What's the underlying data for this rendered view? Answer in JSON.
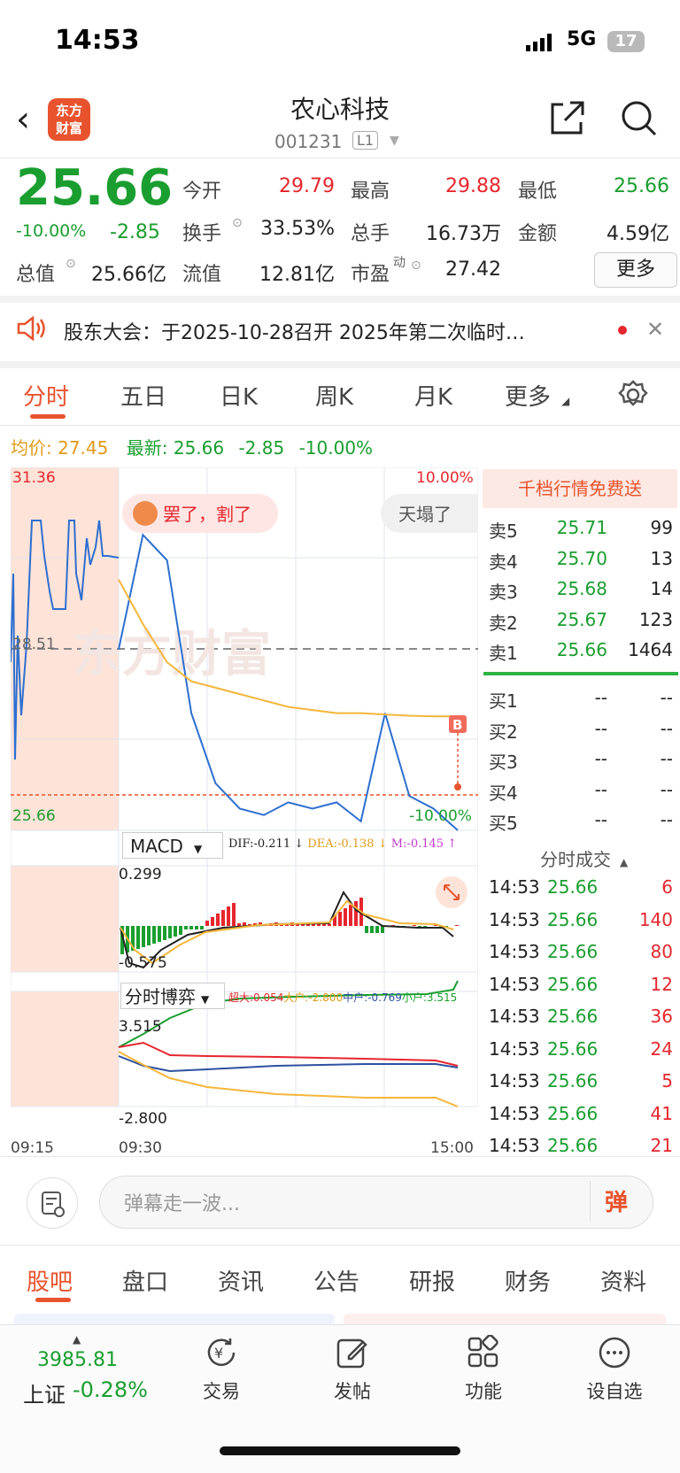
{
  "status_bar": {
    "time": "14:53",
    "network": "5G",
    "battery": "17"
  },
  "header": {
    "logo_text_line1": "东方",
    "logo_text_line2": "财富",
    "stock_name": "农心科技",
    "stock_code": "001231",
    "level_badge": "L1"
  },
  "quote": {
    "price": "25.66",
    "change_pct": "-10.00%",
    "change": "-2.85",
    "open_label": "今开",
    "open": "29.79",
    "high_label": "最高",
    "high": "29.88",
    "low_label": "最低",
    "low": "25.66",
    "turnover_label": "换手",
    "turnover": "33.53%",
    "volume_label": "总手",
    "volume": "16.73万",
    "amount_label": "金额",
    "amount": "4.59亿",
    "mktcap_label": "总值",
    "mktcap": "25.66亿",
    "float_label": "流值",
    "float": "12.81亿",
    "pe_label": "市盈",
    "pe_sup": "动",
    "pe": "27.42",
    "more_button": "更多"
  },
  "announcement": {
    "text": "股东大会：于2025-10-28召开 2025年第二次临时…"
  },
  "chart_tabs": [
    "分时",
    "五日",
    "日K",
    "周K",
    "月K",
    "更多"
  ],
  "info_row": {
    "avg_label": "均价:",
    "avg": "27.45",
    "latest_label": "最新:",
    "latest": "25.66",
    "change": "-2.85",
    "change_pct": "-10.00%"
  },
  "chart": {
    "top_left": "31.36",
    "top_right": "10.00%",
    "mid_left": "28.51",
    "bottom_left": "25.66",
    "bottom_right": "-10.00%",
    "bubble1": "罢了，割了",
    "bubble2": "天塌了",
    "b_marker": "B",
    "macd_label": "MACD",
    "macd_dif": "DIF:-0.211",
    "macd_dea": "DEA:-0.138",
    "macd_m": "M:-0.145",
    "macd_top": "0.299",
    "macd_bottom": "-0.575",
    "game_label": "分时博弈",
    "game_super": "超大:0.054",
    "game_big": "大户:-2.800",
    "game_mid": "中户:-0.769",
    "game_small": "小户:3.515",
    "game_top": "3.515",
    "game_bottom": "-2.800",
    "times": [
      "09:15",
      "09:30",
      "15:00"
    ],
    "watermark": "东方财富"
  },
  "chart_data": {
    "type": "line",
    "title": "",
    "x": [
      "09:15",
      "09:30",
      "15:00"
    ],
    "ylim": [
      25.66,
      31.36
    ],
    "series": [
      {
        "name": "最新",
        "values": [
          28.5,
          30.3,
          29.9,
          27.5,
          26.4,
          26.0,
          25.9,
          26.1,
          26.0,
          26.1,
          25.8,
          27.5,
          26.2,
          26.0,
          25.66
        ]
      },
      {
        "name": "均价",
        "values": [
          29.6,
          28.9,
          28.3,
          28.0,
          27.9,
          27.8,
          27.7,
          27.6,
          27.55,
          27.5,
          27.5,
          27.48,
          27.46,
          27.45,
          27.45
        ]
      }
    ]
  },
  "orderbook": {
    "free_banner": "千档行情免费送",
    "asks": [
      {
        "label": "卖5",
        "price": "25.71",
        "vol": "99"
      },
      {
        "label": "卖4",
        "price": "25.70",
        "vol": "13"
      },
      {
        "label": "卖3",
        "price": "25.68",
        "vol": "14"
      },
      {
        "label": "卖2",
        "price": "25.67",
        "vol": "123"
      },
      {
        "label": "卖1",
        "price": "25.66",
        "vol": "1464"
      }
    ],
    "bids": [
      {
        "label": "买1",
        "price": "--",
        "vol": "--"
      },
      {
        "label": "买2",
        "price": "--",
        "vol": "--"
      },
      {
        "label": "买3",
        "price": "--",
        "vol": "--"
      },
      {
        "label": "买4",
        "price": "--",
        "vol": "--"
      },
      {
        "label": "买5",
        "price": "--",
        "vol": "--"
      }
    ],
    "trades_title": "分时成交",
    "trades": [
      {
        "time": "14:53",
        "price": "25.66",
        "vol": "6"
      },
      {
        "time": "14:53",
        "price": "25.66",
        "vol": "140"
      },
      {
        "time": "14:53",
        "price": "25.66",
        "vol": "80"
      },
      {
        "time": "14:53",
        "price": "25.66",
        "vol": "12"
      },
      {
        "time": "14:53",
        "price": "25.66",
        "vol": "36"
      },
      {
        "time": "14:53",
        "price": "25.66",
        "vol": "24"
      },
      {
        "time": "14:53",
        "price": "25.66",
        "vol": "5"
      },
      {
        "time": "14:53",
        "price": "25.66",
        "vol": "41"
      },
      {
        "time": "14:53",
        "price": "25.66",
        "vol": "21"
      }
    ]
  },
  "comment": {
    "placeholder": "弹幕走一波...",
    "dan": "弹"
  },
  "bottom_tabs": [
    "股吧",
    "盘口",
    "资讯",
    "公告",
    "研报",
    "财务",
    "资料"
  ],
  "nav": {
    "index_value": "3985.81",
    "index_name": "上证",
    "index_pct": "-0.28%",
    "items": [
      "交易",
      "发帖",
      "功能",
      "设自选"
    ]
  },
  "colors": {
    "up": "#e6262e",
    "down": "#1a9e2f",
    "accent": "#e8532d",
    "avg_line": "#f5b63a",
    "price_line": "#2d6fd0"
  }
}
